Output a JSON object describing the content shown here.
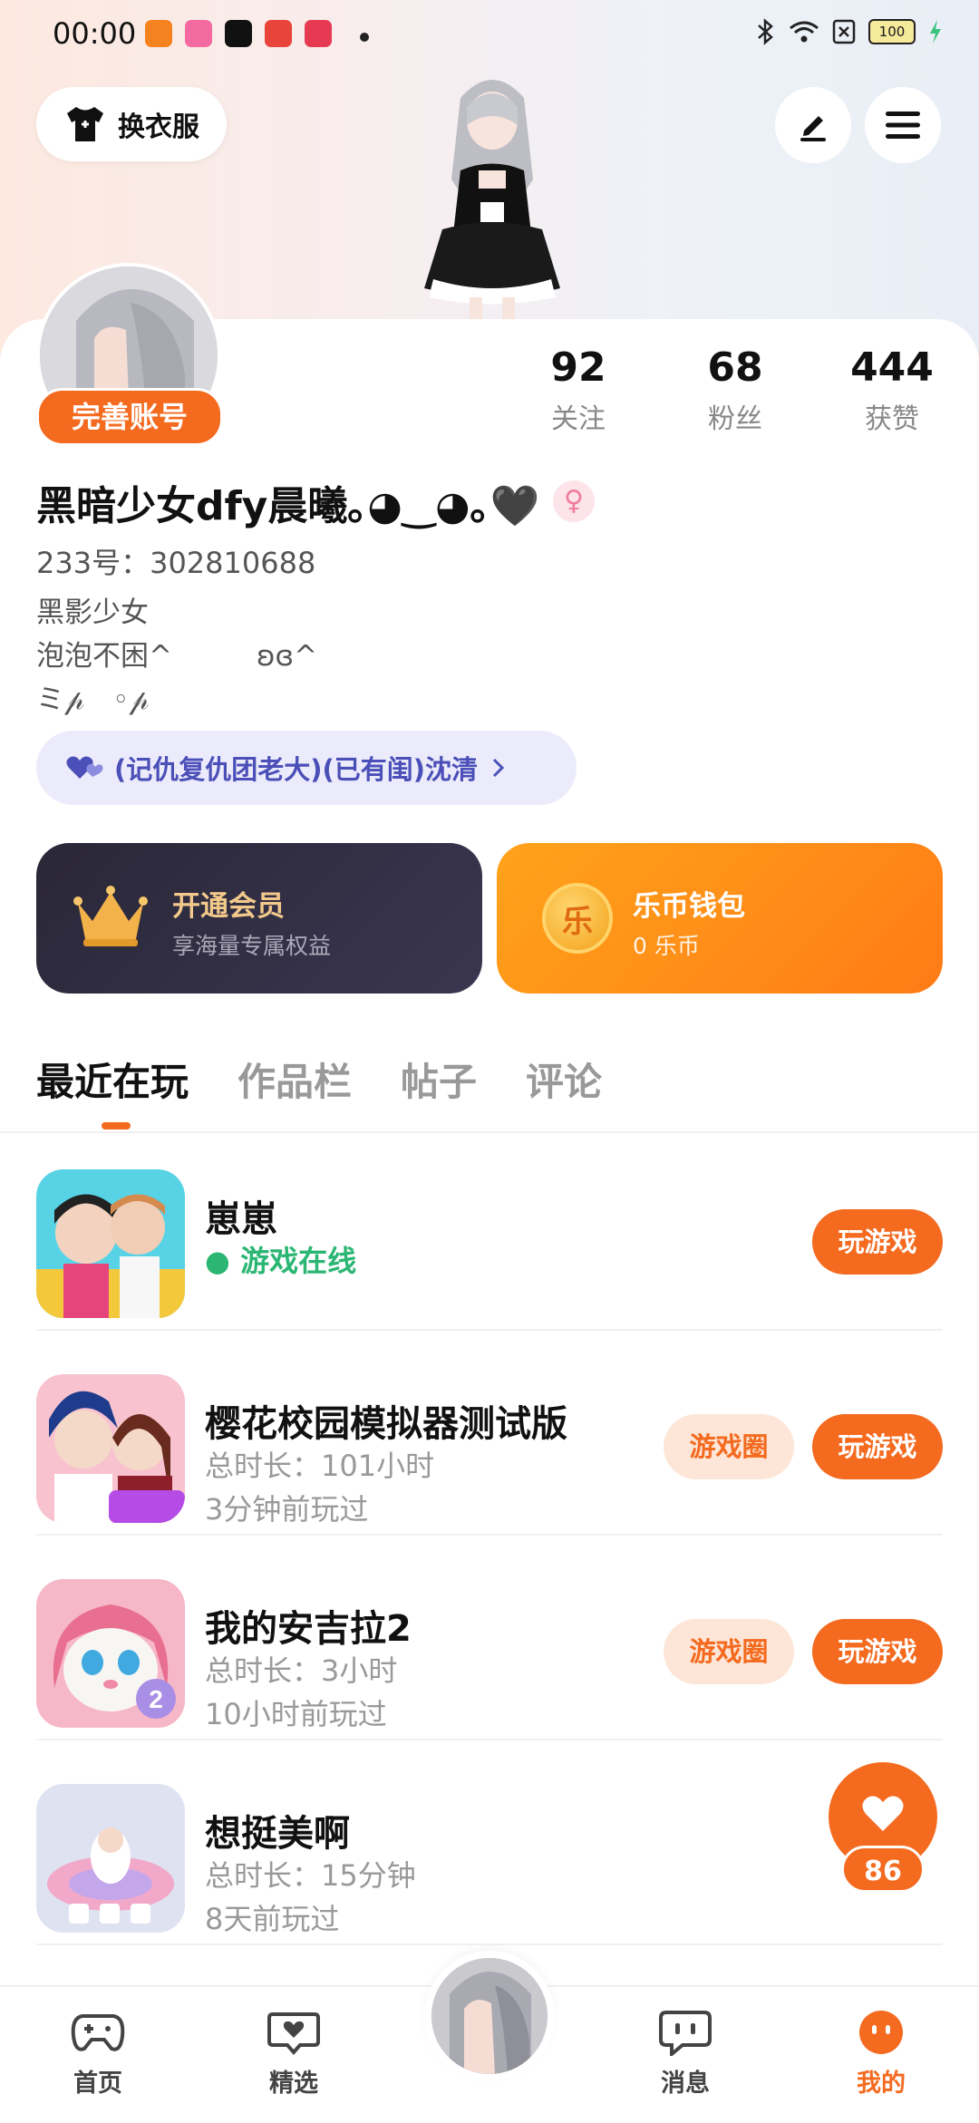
{
  "status_bar": {
    "time": "00:00",
    "battery": "100"
  },
  "header": {
    "outfit_label": "换衣服"
  },
  "profile": {
    "badge": "完善账号",
    "nickname": "黑暗少女dfy晨曦｡◕‿◕｡🖤",
    "uid": "233号：302810688",
    "bio": "黑影少女\n泡泡不困^　　　ʚɞ^\nミ𝓅　◦𝓅",
    "cp_text": "(记仇复仇团老大)(已有闺)沈清"
  },
  "stats": [
    {
      "num": "92",
      "label": "关注"
    },
    {
      "num": "68",
      "label": "粉丝"
    },
    {
      "num": "444",
      "label": "获赞"
    }
  ],
  "vip": {
    "title": "开通会员",
    "subtitle": "享海量专属权益"
  },
  "wallet": {
    "title": "乐币钱包",
    "subtitle": "0 乐币",
    "coin_glyph": "乐"
  },
  "tabs": [
    "最近在玩",
    "作品栏",
    "帖子",
    "评论"
  ],
  "games": [
    {
      "name": "崽崽",
      "status": "游戏在线",
      "play": "玩游戏"
    },
    {
      "name": "樱花校园模拟器测试版",
      "duration": "总时长：101小时",
      "last": "3分钟前玩过",
      "circle": "游戏圈",
      "play": "玩游戏"
    },
    {
      "name": "我的安吉拉2",
      "duration": "总时长：3小时",
      "last": "10小时前玩过",
      "circle": "游戏圈",
      "play": "玩游戏"
    },
    {
      "name": "想挺美啊",
      "duration": "总时长：15分钟",
      "last": "8天前玩过"
    }
  ],
  "like_fab": {
    "count": "86"
  },
  "nav": [
    {
      "label": "首页",
      "icon": "gamepad-icon"
    },
    {
      "label": "精选",
      "icon": "heart-chat-icon"
    },
    {
      "label": "消息",
      "icon": "message-icon"
    },
    {
      "label": "我的",
      "icon": "profile-face-icon"
    }
  ],
  "colors": {
    "accent": "#f46a1f",
    "online": "#2bb673",
    "vip_bg": "#2a2738"
  }
}
